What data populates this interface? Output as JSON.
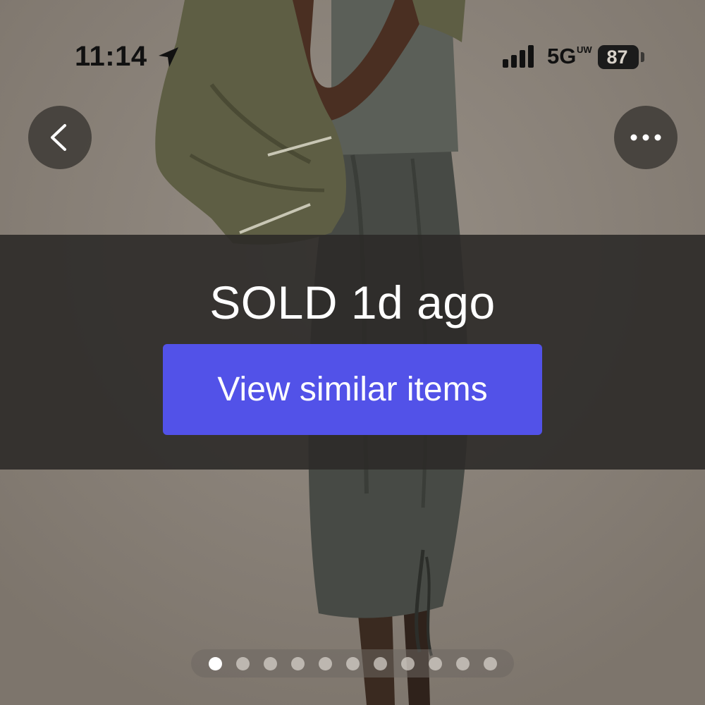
{
  "status_bar": {
    "time": "11:14",
    "network": "5G",
    "network_badge": "UW",
    "battery": "87",
    "location_icon": "location-arrow-icon",
    "signal_icon": "cellular-signal-icon"
  },
  "nav": {
    "back_icon": "chevron-left-icon",
    "more_icon": "ellipsis-icon"
  },
  "listing": {
    "sold_label": "SOLD 1d ago",
    "similar_button_label": "View similar items"
  },
  "carousel": {
    "total_images": 11,
    "active_index": 0
  },
  "colors": {
    "accent": "#5252e8",
    "overlay": "#2c2a28",
    "background": "#877f76"
  }
}
